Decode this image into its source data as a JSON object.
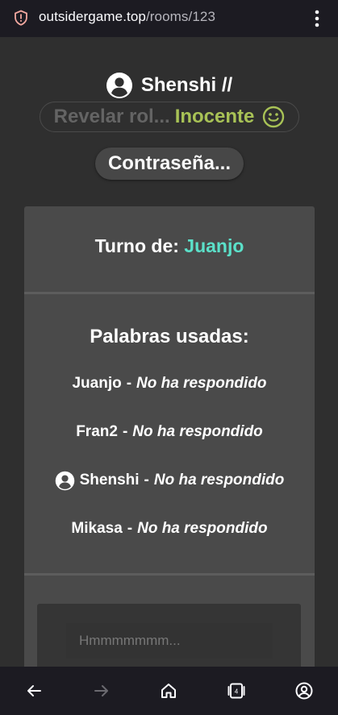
{
  "browser": {
    "url_domain": "outsidergame.top",
    "url_path": "/rooms/123"
  },
  "header": {
    "username": "Shenshi //",
    "reveal_label": "Revelar rol...",
    "role_label": "Inocente",
    "password_button": "Contraseña..."
  },
  "turn": {
    "label": "Turno de:",
    "player": "Juanjo"
  },
  "words": {
    "title": "Palabras usadas:",
    "separator": "-",
    "rows": [
      {
        "player": "Juanjo",
        "status": "No ha respondido",
        "is_self": false
      },
      {
        "player": "Fran2",
        "status": "No ha respondido",
        "is_self": false
      },
      {
        "player": "Shenshi",
        "status": "No ha respondido",
        "is_self": true
      },
      {
        "player": "Mikasa",
        "status": "No ha respondido",
        "is_self": false
      }
    ]
  },
  "answer": {
    "placeholder": "Hmmmmmmm..."
  },
  "nav": {
    "tab_count": "4"
  },
  "colors": {
    "turn_name": "#5be0c9",
    "role": "#a8c256",
    "reveal": "#646464"
  },
  "icons": [
    "shield-icon",
    "menu-dots-icon",
    "user-avatar-icon",
    "smile-icon",
    "back-arrow-icon",
    "forward-arrow-icon",
    "home-icon",
    "tabs-icon",
    "account-icon"
  ]
}
